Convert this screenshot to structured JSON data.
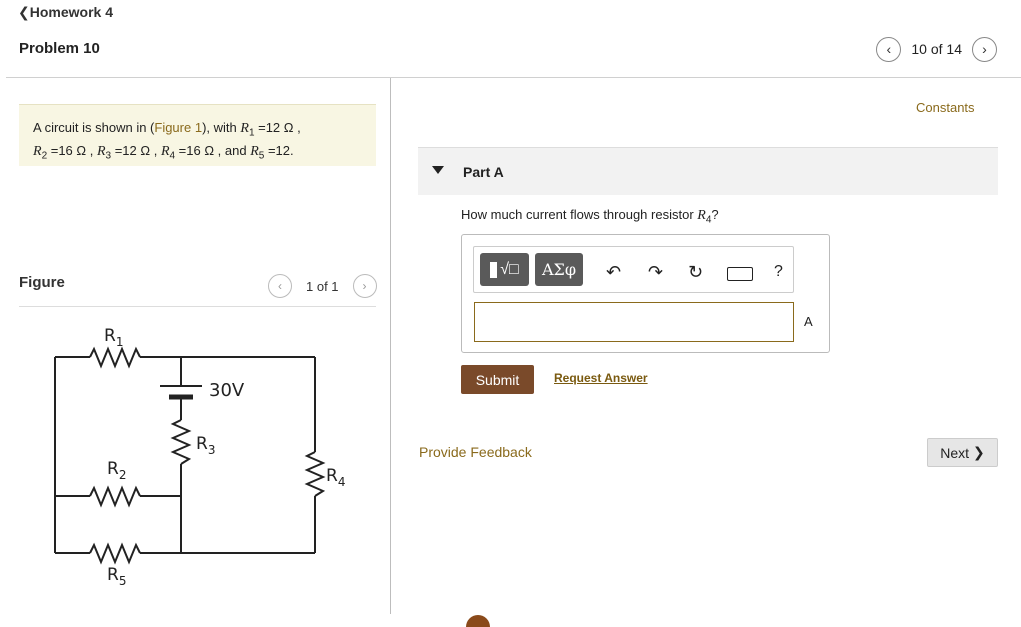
{
  "header": {
    "back_label": "Homework 4",
    "problem_title": "Problem 10",
    "pager": {
      "text": "10 of 14",
      "prev_icon": "chevron-left-icon",
      "next_icon": "chevron-right-icon"
    }
  },
  "intro": {
    "t1": "A circuit is shown in (",
    "fig": "Figure 1",
    "t2": "), with ",
    "r1": "R",
    "r1s": "1",
    "v1": " =12 Ω ,",
    "r2": "R",
    "r2s": "2",
    "v2": " =16 Ω , ",
    "r3": "R",
    "r3s": "3",
    "v3": " =12 Ω , ",
    "r4": "R",
    "r4s": "4",
    "v4": " =16 Ω , and ",
    "r5": "R",
    "r5s": "5",
    "v5": " =12."
  },
  "figure": {
    "label": "Figure",
    "pager_text": "1 of 1",
    "circuit": {
      "battery_label": "30V",
      "labels": [
        "R1",
        "R2",
        "R3",
        "R4",
        "R5"
      ]
    }
  },
  "right": {
    "constants": "Constants",
    "part_label": "Part A",
    "question_pre": "How much current flows through resistor ",
    "question_var": "R",
    "question_sub": "4",
    "question_post": "?",
    "toolbar": {
      "templates": "√□",
      "greek": "ΑΣφ",
      "undo_icon": "undo-icon",
      "redo_icon": "redo-icon",
      "reset_icon": "reset-icon",
      "keyboard_icon": "keyboard-icon",
      "help": "?"
    },
    "answer_value": "",
    "unit": "A",
    "submit": "Submit",
    "request": "Request Answer",
    "feedback": "Provide Feedback",
    "next": "Next"
  },
  "colors": {
    "accent": "#8a6a1c",
    "submit": "#7a4a2a",
    "intro_bg": "#f8f6e3"
  }
}
